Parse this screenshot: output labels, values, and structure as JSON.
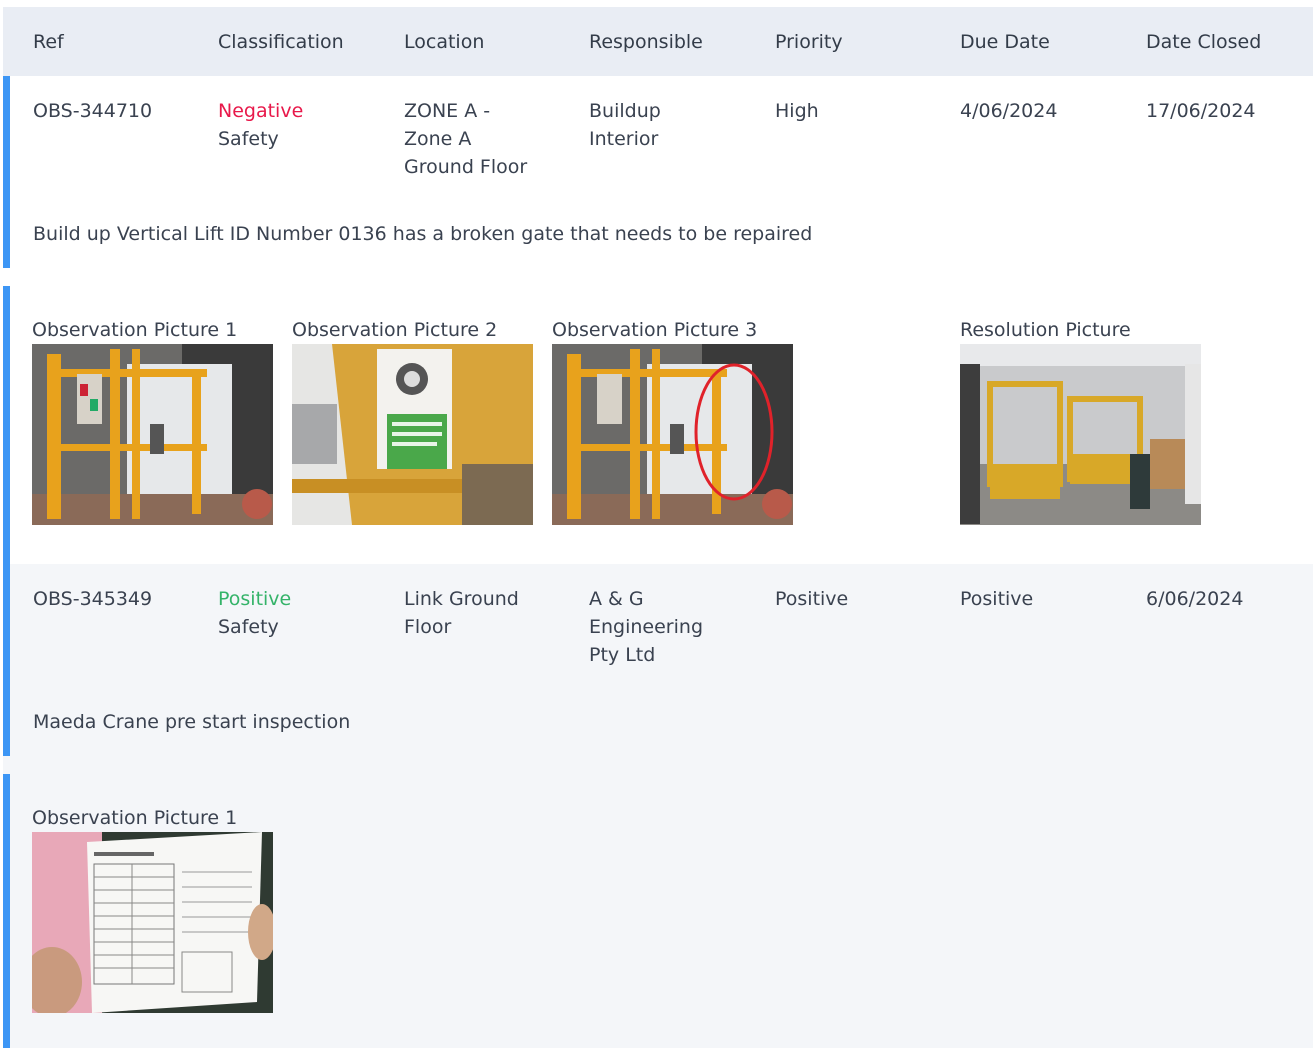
{
  "header": {
    "ref": "Ref",
    "classification": "Classification",
    "location": "Location",
    "responsible": "Responsible",
    "priority": "Priority",
    "due_date": "Due Date",
    "date_closed": "Date Closed"
  },
  "rows": [
    {
      "ref": "OBS-344710",
      "class_type": "Negative",
      "class_sub": "Safety",
      "location_lines": [
        "ZONE A -",
        "Zone A",
        "Ground Floor"
      ],
      "responsible_lines": [
        "Buildup",
        "Interior"
      ],
      "priority": "High",
      "due_date": "4/06/2024",
      "date_closed": "17/06/2024",
      "description": "Build up Vertical Lift ID Number 0136 has a broken gate that needs to be repaired",
      "pictures": [
        {
          "label": "Observation Picture 1",
          "icon": "lift-gate-photo"
        },
        {
          "label": "Observation Picture 2",
          "icon": "equipment-sticker-photo"
        },
        {
          "label": "Observation Picture 3",
          "icon": "lift-gate-circled-photo"
        },
        {
          "label": "Resolution Picture",
          "icon": "lifts-storage-photo"
        }
      ]
    },
    {
      "ref": "OBS-345349",
      "class_type": "Positive",
      "class_sub": "Safety",
      "location_lines": [
        "Link Ground",
        "Floor"
      ],
      "responsible_lines": [
        "A & G",
        "Engineering",
        "Pty Ltd"
      ],
      "priority": "Positive",
      "due_date": "Positive",
      "date_closed": "6/06/2024",
      "description": "Maeda Crane pre start inspection",
      "pictures": [
        {
          "label": "Observation Picture 1",
          "icon": "inspection-form-photo"
        }
      ]
    }
  ],
  "colors": {
    "header_bg": "#e9edf4",
    "accent_bar": "#3d96f5",
    "negative": "#e8184a",
    "positive": "#34b369",
    "alt_row_bg": "#f4f6f9"
  }
}
